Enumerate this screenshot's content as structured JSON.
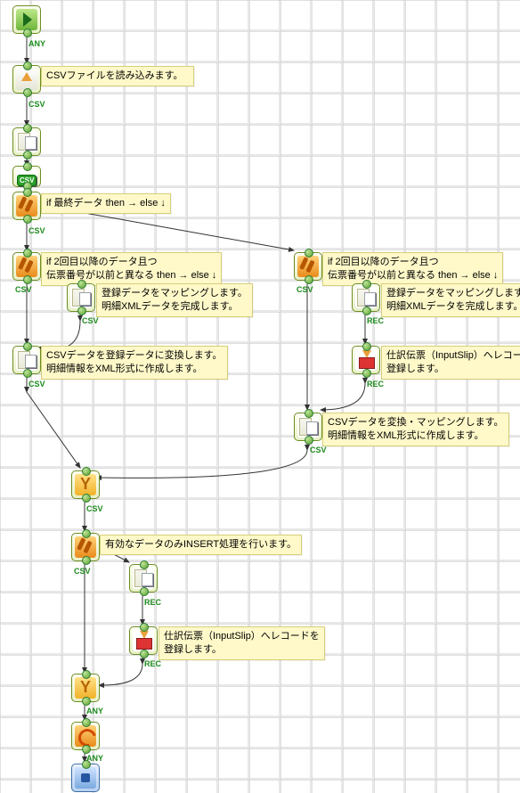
{
  "tags": {
    "any": "ANY",
    "csv": "CSV",
    "rec": "REC"
  },
  "n": {
    "readCsv": "CSVファイルを読み込みます。",
    "finalBranch": "if 最終データ then → else ↓",
    "secondBranchL": "if 2回目以降のデータ且つ\n伝票番号が以前と異なる then → else ↓",
    "secondBranchR": "if 2回目以降のデータ且つ\n伝票番号が以前と異なる then → else ↓",
    "mapL": "登録データをマッピングします。\n明細XMLデータを完成します。",
    "mapR": "登録データをマッピングします。\n明細XMLデータを完成します。",
    "convL": "CSVデータを登録データに変換します。\n明細情報をXML形式に作成します。",
    "convR": "CSVデータを変換・マッピングします。\n明細情報をXML形式に作成します。",
    "insR": "仕訳伝票（InputSlip）へレコードを\n登録します。",
    "validBranch": "有効なデータのみINSERT処理を行います。",
    "ins2": "仕訳伝票（InputSlip）へレコードを\n登録します。"
  }
}
